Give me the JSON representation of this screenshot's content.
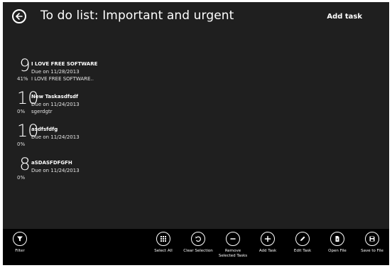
{
  "header": {
    "title": "To do list: Important and urgent",
    "add_task_label": "Add task",
    "back_icon": "back-arrow-icon"
  },
  "tasks": [
    {
      "priority": "9",
      "progress": "41%",
      "title": "I LOVE FREE SOFTWARE",
      "due": "Due on 11/28/2013",
      "note": "I LOVE FREE SOFTWARE.."
    },
    {
      "priority": "10",
      "progress": "0%",
      "title": "New Taskasdfsdf",
      "due": "Due on 11/24/2013",
      "note": "sgerdgtr"
    },
    {
      "priority": "10",
      "progress": "0%",
      "title": "asdfsfdfg",
      "due": "Due on 11/24/2013",
      "note": ""
    },
    {
      "priority": "8",
      "progress": "0%",
      "title": "aSDASFDFGFH",
      "due": "Due on 11/24/2013",
      "note": ""
    }
  ],
  "app_bar": {
    "filter": {
      "label": "Filter",
      "icon": "filter-icon"
    },
    "select_all": {
      "label": "Select All",
      "icon": "grid-icon"
    },
    "clear_selection": {
      "label": "Clear Selection",
      "icon": "undo-icon"
    },
    "remove_selected": {
      "label_line1": "Remove",
      "label_line2": "Selected Tasks",
      "icon": "minus-icon"
    },
    "add_task": {
      "label": "Add Task",
      "icon": "plus-icon"
    },
    "edit_task": {
      "label": "Edit Task",
      "icon": "pencil-icon"
    },
    "open_file": {
      "label": "Open File",
      "icon": "file-icon"
    },
    "save_to_file": {
      "label": "Save to File",
      "icon": "save-icon"
    }
  },
  "colors": {
    "background": "#1f1f1f",
    "app_bar": "#000000",
    "text": "#ffffff"
  }
}
